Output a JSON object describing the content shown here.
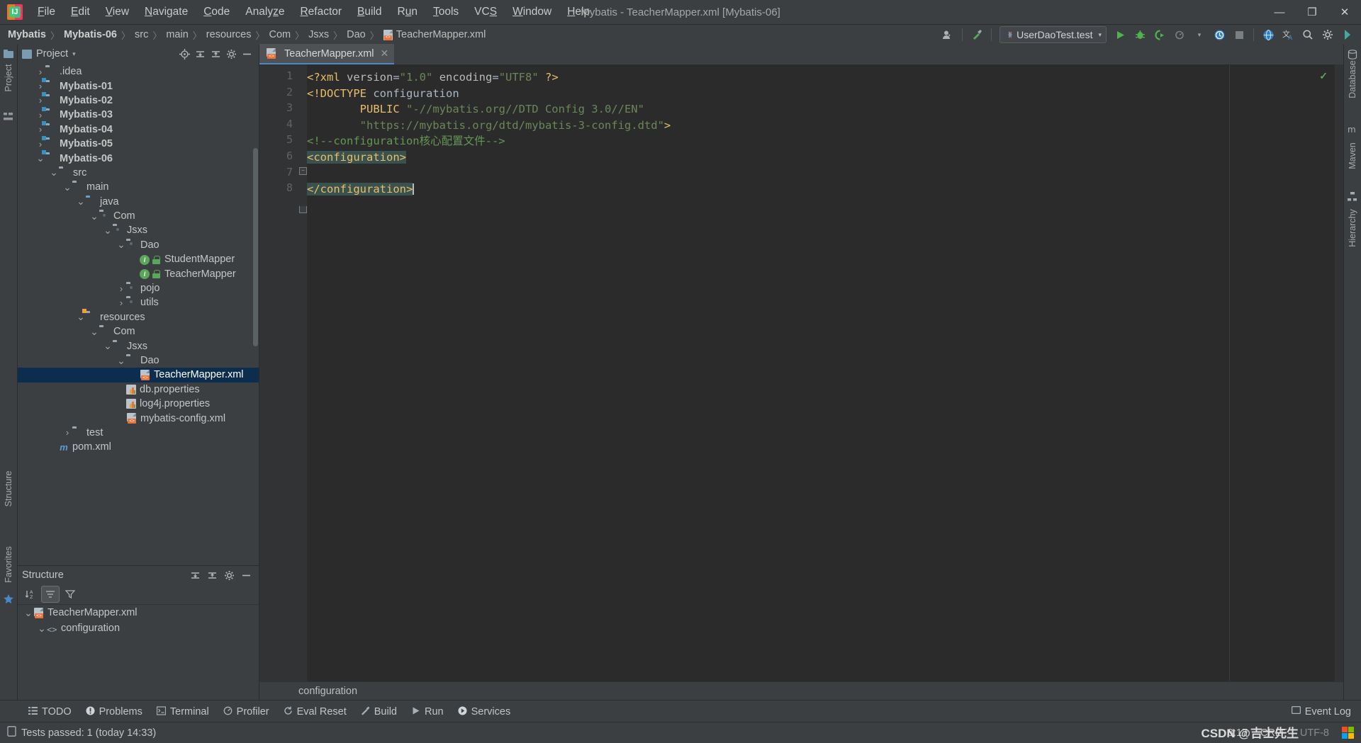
{
  "window": {
    "title": "Mybatis - TeacherMapper.xml [Mybatis-06]",
    "minimize": "—",
    "maximize": "❐",
    "close": "✕"
  },
  "menubar": {
    "items": [
      {
        "label": "File"
      },
      {
        "label": "Edit"
      },
      {
        "label": "View"
      },
      {
        "label": "Navigate"
      },
      {
        "label": "Code"
      },
      {
        "label": "Analyze"
      },
      {
        "label": "Refactor"
      },
      {
        "label": "Build"
      },
      {
        "label": "Run"
      },
      {
        "label": "Tools"
      },
      {
        "label": "VCS"
      },
      {
        "label": "Window"
      },
      {
        "label": "Help"
      }
    ]
  },
  "breadcrumbs": {
    "items": [
      {
        "label": "Mybatis",
        "bold": true
      },
      {
        "label": "Mybatis-06",
        "bold": true
      },
      {
        "label": "src"
      },
      {
        "label": "main"
      },
      {
        "label": "resources"
      },
      {
        "label": "Com"
      },
      {
        "label": "Jsxs"
      },
      {
        "label": "Dao"
      },
      {
        "label": "TeacherMapper.xml",
        "icon": "xml-file-icon"
      }
    ],
    "separator": "〉"
  },
  "toolbar": {
    "run_config": "UserDaoTest.test",
    "dropdown_arrow": "▾",
    "icons": [
      "user-account-icon",
      "hammer-build-icon",
      "run-icon",
      "debug-icon",
      "run-coverage-icon",
      "profile-icon",
      "updates-icon",
      "stop-icon",
      "search-everywhere-globe-icon",
      "translate-icon",
      "search-icon",
      "settings-gear-icon",
      "ide-theme-icon"
    ]
  },
  "project_panel": {
    "title": "Project",
    "dropdown": "▾",
    "header_buttons": [
      "locate-icon",
      "collapse-all-icon",
      "expand-all-icon",
      "settings-gear-icon",
      "hide-icon"
    ],
    "tree": [
      {
        "label": ".idea",
        "indent": 1,
        "arrow": "›",
        "icon": "folder-gray",
        "bold": false
      },
      {
        "label": "Mybatis-01",
        "indent": 1,
        "arrow": "›",
        "icon": "folder-module",
        "bold": true
      },
      {
        "label": "Mybatis-02",
        "indent": 1,
        "arrow": "›",
        "icon": "folder-module",
        "bold": true
      },
      {
        "label": "Mybatis-03",
        "indent": 1,
        "arrow": "›",
        "icon": "folder-module",
        "bold": true
      },
      {
        "label": "Mybatis-04",
        "indent": 1,
        "arrow": "›",
        "icon": "folder-module",
        "bold": true
      },
      {
        "label": "Mybatis-05",
        "indent": 1,
        "arrow": "›",
        "icon": "folder-module",
        "bold": true
      },
      {
        "label": "Mybatis-06",
        "indent": 1,
        "arrow": "∨",
        "icon": "folder-module",
        "bold": true
      },
      {
        "label": "src",
        "indent": 2,
        "arrow": "∨",
        "icon": "folder-gray",
        "bold": false
      },
      {
        "label": "main",
        "indent": 3,
        "arrow": "∨",
        "icon": "folder-gray",
        "bold": false
      },
      {
        "label": "java",
        "indent": 4,
        "arrow": "∨",
        "icon": "folder-blue",
        "bold": false
      },
      {
        "label": "Com",
        "indent": 5,
        "arrow": "∨",
        "icon": "folder-package",
        "bold": false
      },
      {
        "label": "Jsxs",
        "indent": 6,
        "arrow": "∨",
        "icon": "folder-package",
        "bold": false
      },
      {
        "label": "Dao",
        "indent": 7,
        "arrow": "∨",
        "icon": "folder-package",
        "bold": false
      },
      {
        "label": "StudentMapper",
        "indent": 8,
        "arrow": "",
        "icon": "interface-icon",
        "bold": false
      },
      {
        "label": "TeacherMapper",
        "indent": 8,
        "arrow": "",
        "icon": "interface-icon",
        "bold": false
      },
      {
        "label": "pojo",
        "indent": 7,
        "arrow": "›",
        "icon": "folder-package",
        "bold": false
      },
      {
        "label": "utils",
        "indent": 7,
        "arrow": "›",
        "icon": "folder-package",
        "bold": false
      },
      {
        "label": "resources",
        "indent": 4,
        "arrow": "∨",
        "icon": "folder-resources",
        "bold": false
      },
      {
        "label": "Com",
        "indent": 5,
        "arrow": "∨",
        "icon": "folder-gray",
        "bold": false
      },
      {
        "label": "Jsxs",
        "indent": 6,
        "arrow": "∨",
        "icon": "folder-gray",
        "bold": false
      },
      {
        "label": "Dao",
        "indent": 7,
        "arrow": "∨",
        "icon": "folder-gray",
        "bold": false
      },
      {
        "label": "TeacherMapper.xml",
        "indent": 8,
        "arrow": "",
        "icon": "xml-file-icon",
        "bold": false,
        "selected": true
      },
      {
        "label": "db.properties",
        "indent": 7,
        "arrow": "",
        "icon": "properties-icon",
        "bold": false
      },
      {
        "label": "log4j.properties",
        "indent": 7,
        "arrow": "",
        "icon": "properties-icon",
        "bold": false
      },
      {
        "label": "mybatis-config.xml",
        "indent": 7,
        "arrow": "",
        "icon": "xml-file-icon",
        "bold": false
      },
      {
        "label": "test",
        "indent": 3,
        "arrow": "›",
        "icon": "folder-gray",
        "bold": false
      },
      {
        "label": "pom.xml",
        "indent": 2,
        "arrow": "",
        "icon": "maven-icon",
        "bold": false
      }
    ]
  },
  "structure_panel": {
    "title": "Structure",
    "header_buttons": [
      "collapse-all-icon",
      "expand-all-icon",
      "settings-gear-icon",
      "hide-icon"
    ],
    "toolbar_buttons": [
      "sort-alphabetically-icon",
      "show-attributes-icon",
      "filter-icon"
    ],
    "tree": [
      {
        "label": "TeacherMapper.xml",
        "indent": 0,
        "arrow": "∨",
        "icon": "xml-file-icon"
      },
      {
        "label": "configuration",
        "indent": 1,
        "arrow": "∨",
        "icon": "xml-tag-icon"
      }
    ]
  },
  "editor": {
    "tab": {
      "label": "TeacherMapper.xml",
      "icon": "xml-file-icon",
      "close": "✕"
    },
    "breadcrumb": "configuration",
    "inspection_status": "✓",
    "line_numbers": [
      "1",
      "2",
      "3",
      "4",
      "5",
      "6",
      "7",
      "8"
    ],
    "code_lines": [
      {
        "n": 1,
        "tokens": [
          {
            "t": "<?xml ",
            "c": "tk-kw"
          },
          {
            "t": "version",
            "c": "tk-attr"
          },
          {
            "t": "=",
            "c": "tk-plain"
          },
          {
            "t": "\"1.0\"",
            "c": "tk-str"
          },
          {
            "t": " ",
            "c": "tk-plain"
          },
          {
            "t": "encoding",
            "c": "tk-attr"
          },
          {
            "t": "=",
            "c": "tk-plain"
          },
          {
            "t": "\"UTF8\"",
            "c": "tk-str"
          },
          {
            "t": " ",
            "c": "tk-plain"
          },
          {
            "t": "?>",
            "c": "tk-kw"
          }
        ]
      },
      {
        "n": 2,
        "tokens": [
          {
            "t": "<!",
            "c": "tk-kw"
          },
          {
            "t": "DOCTYPE",
            "c": "tk-kw"
          },
          {
            "t": " configuration",
            "c": "tk-plain"
          }
        ]
      },
      {
        "n": 3,
        "tokens": [
          {
            "t": "        ",
            "c": "tk-plain"
          },
          {
            "t": "PUBLIC",
            "c": "tk-kw"
          },
          {
            "t": " ",
            "c": "tk-plain"
          },
          {
            "t": "\"-//mybatis.org//DTD Config 3.0//EN\"",
            "c": "tk-str"
          }
        ]
      },
      {
        "n": 4,
        "tokens": [
          {
            "t": "        ",
            "c": "tk-plain"
          },
          {
            "t": "\"https://mybatis.org/dtd/mybatis-3-config.dtd\"",
            "c": "tk-str"
          },
          {
            "t": ">",
            "c": "tk-kw"
          }
        ]
      },
      {
        "n": 5,
        "tokens": [
          {
            "t": "<!--configuration核心配置文件-->",
            "c": "tk-comment"
          }
        ]
      },
      {
        "n": 6,
        "tokens": [
          {
            "t": "<configuration>",
            "c": "tk-kw hl"
          }
        ]
      },
      {
        "n": 7,
        "tokens": []
      },
      {
        "n": 8,
        "tokens": [
          {
            "t": "</configuration>",
            "c": "tk-kw hl"
          },
          {
            "t": "CARET",
            "c": "caret"
          }
        ]
      }
    ]
  },
  "left_rail": [
    {
      "label": "Project",
      "icon": "project-icon"
    },
    {
      "label": "Structure",
      "icon": "structure-icon"
    },
    {
      "label": "Favorites",
      "icon": "favorites-star-icon"
    }
  ],
  "right_rail": [
    {
      "label": "Database",
      "icon": "database-icon"
    },
    {
      "label": "Maven",
      "icon": "maven-m-icon"
    },
    {
      "label": "Hierarchy",
      "icon": "hierarchy-icon"
    }
  ],
  "bottom_bar": {
    "buttons": [
      {
        "label": "TODO",
        "icon": "todo-list-icon"
      },
      {
        "label": "Problems",
        "icon": "problems-warning-icon"
      },
      {
        "label": "Terminal",
        "icon": "terminal-icon"
      },
      {
        "label": "Profiler",
        "icon": "profiler-icon"
      },
      {
        "label": "Eval Reset",
        "icon": "eval-reset-icon"
      },
      {
        "label": "Build",
        "icon": "build-hammer-icon"
      },
      {
        "label": "Run",
        "icon": "run-play-icon"
      },
      {
        "label": "Services",
        "icon": "services-icon"
      }
    ],
    "event_log": {
      "label": "Event Log",
      "icon": "event-log-icon"
    }
  },
  "status_bar": {
    "message": "Tests passed: 1 (today 14:33)",
    "message_icon": "test-status-icon",
    "caret_position": "8:17",
    "line_separator": "CRLF",
    "encoding": "UTF-8",
    "watermark": "CSDN @吉士先生",
    "os_icon": "windows-logo-icon"
  },
  "colors": {
    "accent_blue": "#4a88c7",
    "selection_blue": "#0d2d4e",
    "editor_bg": "#2b2b2b",
    "panel_bg": "#3c3f41",
    "string_green": "#6a8759",
    "comment_green": "#629755",
    "tag_yellow": "#e8bf6a",
    "highlight_teal": "#3b514d"
  }
}
